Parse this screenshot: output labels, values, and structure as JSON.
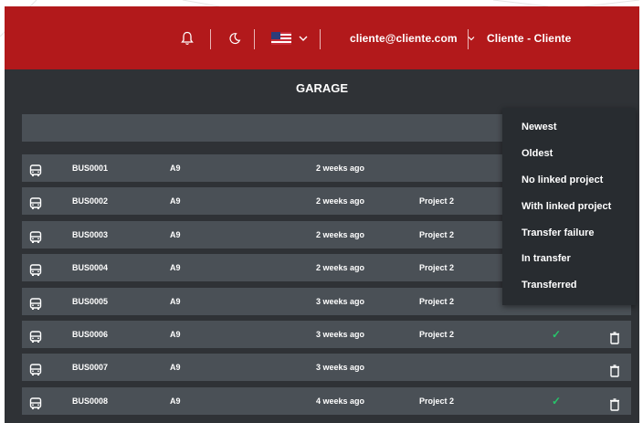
{
  "colors": {
    "topbar": "#b2191b",
    "background": "#2f3236",
    "row": "#4a5056",
    "dropdown": "#282c30",
    "check": "#27c46a"
  },
  "header": {
    "notification_icon": "bell-icon",
    "theme_icon": "moon-icon",
    "language_icon": "us-flag-icon",
    "language_dropdown_icon": "chevron-down-icon",
    "user_email": "cliente@cliente.com",
    "user_dropdown_icon": "chevron-down-icon",
    "user_name": "Cliente - Cliente"
  },
  "page": {
    "title": "GARAGE"
  },
  "rows": [
    {
      "icon": "bus-icon",
      "id": "BUS0001",
      "model": "A9",
      "time": "2 weeks ago",
      "project": ""
    },
    {
      "icon": "bus-icon",
      "id": "BUS0002",
      "model": "A9",
      "time": "2 weeks ago",
      "project": "Project 2"
    },
    {
      "icon": "bus-icon",
      "id": "BUS0003",
      "model": "A9",
      "time": "2 weeks ago",
      "project": "Project 2"
    },
    {
      "icon": "bus-icon",
      "id": "BUS0004",
      "model": "A9",
      "time": "2 weeks ago",
      "project": "Project 2"
    },
    {
      "icon": "bus-icon",
      "id": "BUS0005",
      "model": "A9",
      "time": "3 weeks ago",
      "project": "Project 2"
    },
    {
      "icon": "bus-icon",
      "id": "BUS0006",
      "model": "A9",
      "time": "3 weeks ago",
      "project": "Project 2",
      "status": "✓",
      "action": "trash-icon"
    },
    {
      "icon": "bus-icon",
      "id": "BUS0007",
      "model": "A9",
      "time": "3 weeks ago",
      "project": "",
      "action": "trash-icon"
    },
    {
      "icon": "bus-icon",
      "id": "BUS0008",
      "model": "A9",
      "time": "4 weeks ago",
      "project": "Project 2",
      "status": "✓",
      "action": "trash-icon"
    }
  ],
  "sort_menu": {
    "options": [
      "Newest",
      "Oldest",
      "No linked project",
      "With linked project",
      "Transfer failure",
      "In transfer",
      "Transferred"
    ]
  }
}
